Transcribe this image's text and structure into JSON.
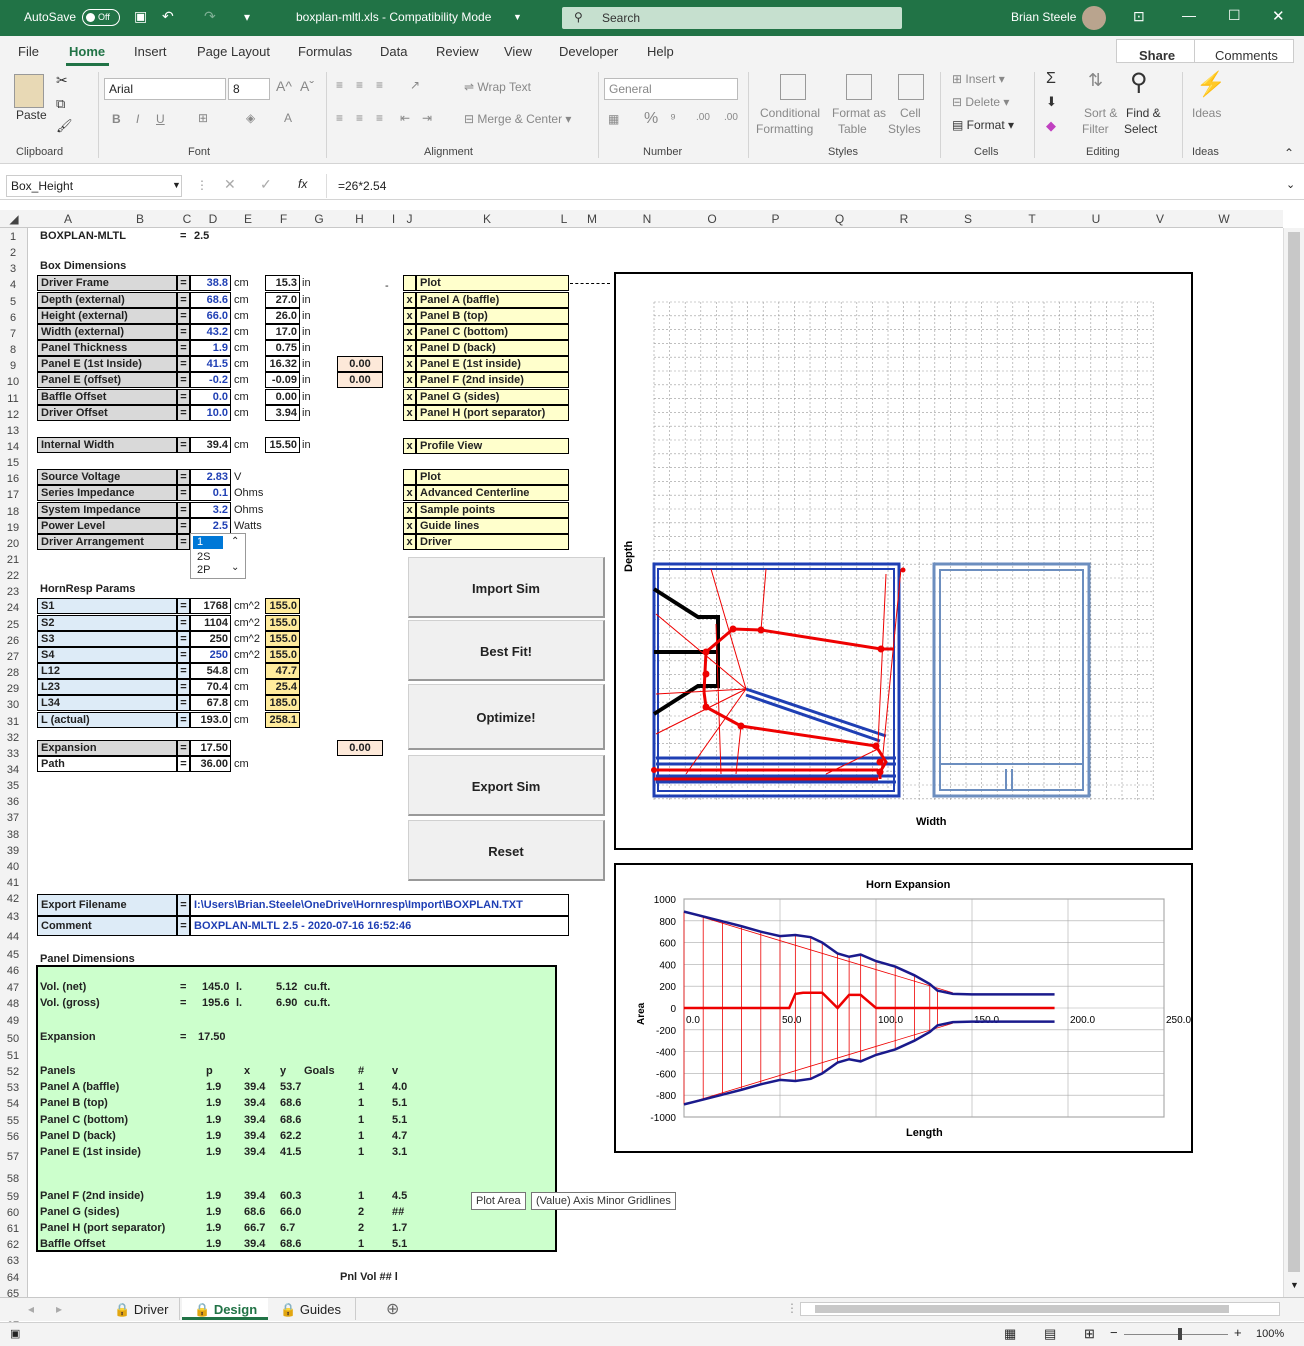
{
  "titlebar": {
    "autosave": "AutoSave",
    "autosave_state": "Off",
    "filename": "boxplan-mltl.xls  -  Compatibility Mode",
    "search": "Search",
    "user": "Brian Steele"
  },
  "menu": [
    "File",
    "Home",
    "Insert",
    "Page Layout",
    "Formulas",
    "Data",
    "Review",
    "View",
    "Developer",
    "Help"
  ],
  "share": "Share",
  "comments": "Comments",
  "ribbon": {
    "paste": "Paste",
    "font_name": "Arial",
    "font_size": "8",
    "wrap": "Wrap Text",
    "merge": "Merge & Center",
    "number_format": "General",
    "cond": "Conditional",
    "cond2": "Formatting",
    "fmt_table": "Format as",
    "fmt_table2": "Table",
    "cell_styles": "Cell",
    "cell_styles2": "Styles",
    "insert": "Insert",
    "delete": "Delete",
    "format": "Format",
    "sort": "Sort &",
    "sort2": "Filter",
    "find": "Find &",
    "find2": "Select",
    "ideas": "Ideas",
    "groups": [
      "Clipboard",
      "Font",
      "Alignment",
      "Number",
      "Styles",
      "Cells",
      "Editing",
      "Ideas"
    ]
  },
  "namebox": "Box_Height",
  "formula": "=26*2.54",
  "columns": [
    "A",
    "B",
    "C",
    "D",
    "E",
    "F",
    "G",
    "H",
    "I",
    "J",
    "K",
    "L",
    "M",
    "N",
    "O",
    "P",
    "Q",
    "R",
    "S",
    "T",
    "U",
    "V",
    "W"
  ],
  "title": {
    "name": "BOXPLAN-MLTL",
    "eq": "=",
    "ver": "2.5"
  },
  "box_dimensions": "Box Dimensions",
  "dims": [
    {
      "label": "Driver Frame",
      "v": "38.8",
      "u": "cm",
      "in": "15.3"
    },
    {
      "label": "Depth (external)",
      "v": "68.6",
      "u": "cm",
      "in": "27.0"
    },
    {
      "label": "Height (external)",
      "v": "66.0",
      "u": "cm",
      "in": "26.0"
    },
    {
      "label": "Width (external)",
      "v": "43.2",
      "u": "cm",
      "in": "17.0"
    },
    {
      "label": "Panel Thickness",
      "v": "1.9",
      "u": "cm",
      "in": "0.75"
    },
    {
      "label": "Panel E (1st Inside)",
      "v": "41.5",
      "u": "cm",
      "in": "16.32",
      "x": "0.00"
    },
    {
      "label": "Panel E (offset)",
      "v": "-0.2",
      "u": "cm",
      "in": "-0.09",
      "x": "0.00"
    },
    {
      "label": "Baffle Offset",
      "v": "0.0",
      "u": "cm",
      "in": "0.00"
    },
    {
      "label": "Driver Offset",
      "v": "10.0",
      "u": "cm",
      "in": "3.94"
    }
  ],
  "internal": {
    "label": "Internal Width",
    "v": "39.4",
    "u": "cm",
    "in": "15.50"
  },
  "inunit": "in",
  "elec": [
    {
      "label": "Source Voltage",
      "v": "2.83",
      "u": "V"
    },
    {
      "label": "Series Impedance",
      "v": "0.1",
      "u": "Ohms"
    },
    {
      "label": "System Impedance",
      "v": "3.2",
      "u": "Ohms"
    },
    {
      "label": "Power Level",
      "v": "2.5",
      "u": "Watts"
    },
    {
      "label": "Driver Arrangement",
      "v": "1",
      "u": ""
    }
  ],
  "dropdown": [
    "1",
    "2S",
    "2P"
  ],
  "hornresp": "HornResp Params",
  "params": [
    {
      "label": "S1",
      "v": "1768",
      "u": "cm^2",
      "y": "155.0"
    },
    {
      "label": "S2",
      "v": "1104",
      "u": "cm^2",
      "y": "155.0"
    },
    {
      "label": "S3",
      "v": "250",
      "u": "cm^2",
      "y": "155.0"
    },
    {
      "label": "S4",
      "v": "250",
      "u": "cm^2",
      "y": "155.0"
    },
    {
      "label": "L12",
      "v": "54.8",
      "u": "cm",
      "y": "47.7"
    },
    {
      "label": "L23",
      "v": "70.4",
      "u": "cm",
      "y": "25.4"
    },
    {
      "label": "L34",
      "v": "67.8",
      "u": "cm",
      "y": "185.0"
    },
    {
      "label": "L (actual)",
      "v": "193.0",
      "u": "cm",
      "y": "258.1"
    }
  ],
  "expansion": {
    "label": "Expansion",
    "v": "17.50",
    "x": "0.00"
  },
  "path": {
    "label": "Path",
    "v": "36.00",
    "u": "cm"
  },
  "plot1": {
    "header": "Plot",
    "items": [
      "Panel A (baffle)",
      "Panel B (top)",
      "Panel C (bottom)",
      "Panel D (back)",
      "Panel E (1st inside)",
      "Panel F (2nd inside)",
      "Panel G (sides)",
      "Panel H (port separator)"
    ]
  },
  "profile": "Profile View",
  "plot2": {
    "header": "Plot",
    "items": [
      "Advanced Centerline",
      "Sample points",
      "Guide lines",
      "Driver"
    ]
  },
  "mark": "x",
  "buttons": [
    "Import Sim",
    "Best Fit!",
    "Optimize!",
    "Export Sim",
    "Reset"
  ],
  "export": {
    "label": "Export Filename",
    "v": "I:\\Users\\Brian.Steele\\OneDrive\\Hornresp\\Import\\BOXPLAN.TXT"
  },
  "comment": {
    "label": "Comment",
    "v": "BOXPLAN-MLTL 2.5 - 2020-07-16 16:52:46"
  },
  "panel_dims": "Panel Dimensions",
  "green": {
    "vnet": [
      "Vol. (net)",
      "=",
      "145.0",
      "l.",
      "5.12",
      "cu.ft."
    ],
    "vgross": [
      "Vol. (gross)",
      "=",
      "195.6",
      "l.",
      "6.90",
      "cu.ft."
    ],
    "exp": [
      "Expansion",
      "=",
      "17.50"
    ],
    "headers": [
      "Panels",
      "p",
      "x",
      "y",
      "Goals",
      "#",
      "v"
    ],
    "rows": [
      [
        "Panel A (baffle)",
        "1.9",
        "39.4",
        "53.7",
        "1",
        "4.0"
      ],
      [
        "Panel B (top)",
        "1.9",
        "39.4",
        "68.6",
        "1",
        "5.1"
      ],
      [
        "Panel C (bottom)",
        "1.9",
        "39.4",
        "68.6",
        "1",
        "5.1"
      ],
      [
        "Panel D (back)",
        "1.9",
        "39.4",
        "62.2",
        "1",
        "4.7"
      ],
      [
        "Panel E (1st inside)",
        "1.9",
        "39.4",
        "41.5",
        "1",
        "3.1"
      ],
      [
        "Panel F (2nd inside)",
        "1.9",
        "39.4",
        "60.3",
        "1",
        "4.5"
      ],
      [
        "Panel G (sides)",
        "1.9",
        "68.6",
        "66.0",
        "2",
        "##"
      ],
      [
        "Panel H (port separator)",
        "1.9",
        "66.7",
        "6.7",
        "2",
        "1.7"
      ],
      [
        "Baffle Offset",
        "1.9",
        "39.4",
        "68.6",
        "1",
        "5.1"
      ]
    ],
    "pnl": "Pnl Vol   ##  l"
  },
  "chart1": {
    "ylabel": "Depth",
    "xlabel": "Width"
  },
  "chart_data": {
    "type": "line",
    "title": "Horn Expansion",
    "xlabel": "Length",
    "ylabel": "Area",
    "xlim": [
      0,
      250
    ],
    "ylim": [
      -1000,
      1000
    ],
    "xticks": [
      "0.0",
      "50.0",
      "100.0",
      "150.0",
      "200.0",
      "250.0"
    ],
    "yticks": [
      "1000",
      "800",
      "600",
      "400",
      "200",
      "0",
      "-200",
      "-400",
      "-600",
      "-800",
      "-1000"
    ],
    "series": [
      {
        "x": [
          0,
          10,
          20,
          30,
          40,
          50,
          58,
          66,
          72,
          80,
          86,
          92,
          100,
          110,
          120,
          128,
          132,
          140,
          150,
          160,
          170,
          180,
          190,
          193
        ],
        "values": [
          884,
          840,
          795,
          750,
          700,
          660,
          670,
          650,
          600,
          500,
          470,
          490,
          430,
          380,
          300,
          220,
          160,
          130,
          125,
          125,
          125,
          125,
          125,
          125
        ]
      },
      {
        "x": [
          0,
          54.8,
          58,
          62,
          72,
          80,
          86,
          92,
          100,
          125.2,
          128,
          193
        ],
        "values": [
          0,
          0,
          130,
          140,
          140,
          0,
          120,
          120,
          0,
          0,
          0,
          0
        ]
      }
    ]
  },
  "tooltip": {
    "a": "Plot Area",
    "b": "(Value) Axis Minor Gridlines"
  },
  "sheets": [
    "Driver",
    "Design",
    "Guides"
  ],
  "zoom": "100%"
}
